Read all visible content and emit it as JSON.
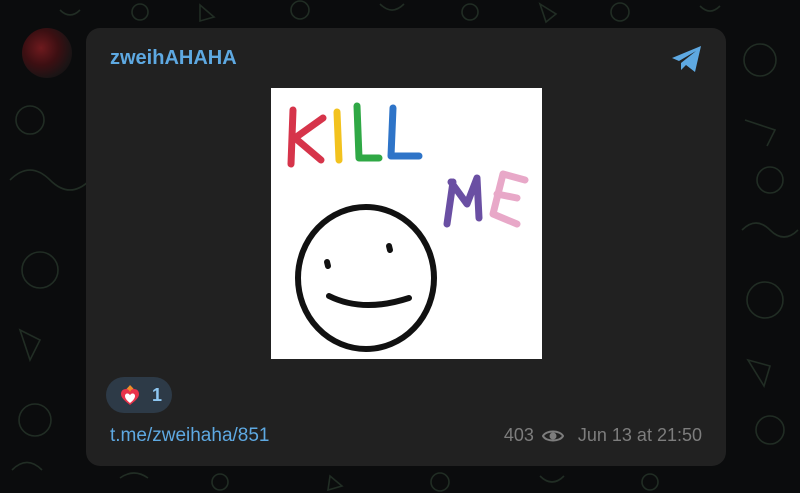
{
  "post": {
    "channel_name": "zweihAHAHA",
    "link": "t.me/zweihaha/851",
    "views": "403",
    "date": "Jun 13 at 21:50",
    "reaction": {
      "emoji": "heart-on-fire",
      "count": "1"
    }
  },
  "image": {
    "caption_word_1": "KILL",
    "caption_word_2": "ME"
  },
  "icons": {
    "platform": "telegram-icon",
    "views": "eye-icon"
  },
  "colors": {
    "background": "#0b0c0d",
    "card": "#212121",
    "accent": "#5ea9e2",
    "meta": "#7d7d7d",
    "reaction_bg": "#2d3a47"
  }
}
